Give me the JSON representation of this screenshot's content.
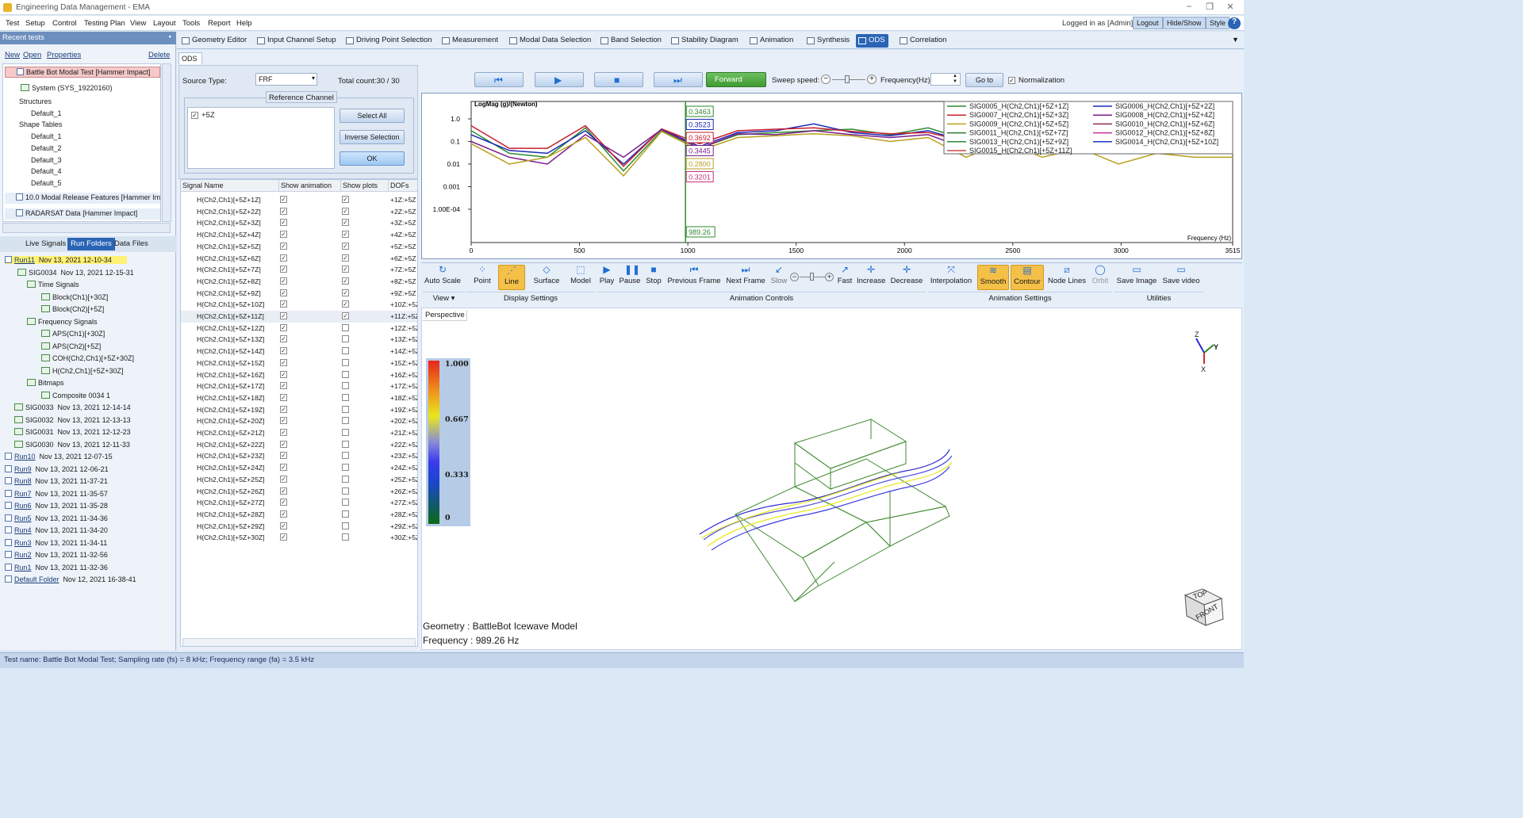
{
  "app": {
    "title": "Engineering Data Management - EMA",
    "menu": [
      "Test",
      "Setup",
      "Control",
      "Testing Plan",
      "View",
      "Layout",
      "Tools",
      "Report",
      "Help"
    ],
    "logged_in": "Logged in as [Admin]",
    "header_buttons": [
      "Logout",
      "Hide/Show",
      "Style"
    ]
  },
  "modules": [
    "Geometry Editor",
    "Input Channel Setup",
    "Driving Point Selection",
    "Measurement",
    "Modal Data Selection",
    "Band Selection",
    "Stability Diagram",
    "Animation",
    "Synthesis",
    "ODS",
    "Correlation"
  ],
  "active_module": "ODS",
  "recent": {
    "header": "Recent tests",
    "actions": [
      "New",
      "Open",
      "Properties",
      "Delete"
    ],
    "items": [
      {
        "label": "Battle Bot Modal Test   [Hammer Impact]"
      },
      {
        "label": "System (SYS_19220160)"
      },
      {
        "label": "Structures"
      },
      {
        "label": "Default_1"
      },
      {
        "label": "Shape Tables"
      },
      {
        "label": "Default_1"
      },
      {
        "label": "Default_2"
      },
      {
        "label": "Default_3"
      },
      {
        "label": "Default_4"
      },
      {
        "label": "Default_5"
      },
      {
        "label": "10.0 Modal Release Features   [Hammer Im"
      },
      {
        "label": "RADARSAT Data   [Hammer Impact]"
      }
    ]
  },
  "left_tabs": [
    "Live Signals",
    "Run Folders",
    "Data Files"
  ],
  "active_left_tab": "Run Folders",
  "runs": [
    {
      "name": "Run11",
      "date": "Nov 13, 2021 12-10-34"
    },
    {
      "name": "SIG0034",
      "date": "Nov 13, 2021 12-15-31"
    },
    {
      "name": "Time Signals",
      "date": ""
    },
    {
      "name": "Block(Ch1)[+30Z]",
      "date": ""
    },
    {
      "name": "Block(Ch2)[+5Z]",
      "date": ""
    },
    {
      "name": "Frequency Signals",
      "date": ""
    },
    {
      "name": "APS(Ch1)[+30Z]",
      "date": ""
    },
    {
      "name": "APS(Ch2)[+5Z]",
      "date": ""
    },
    {
      "name": "COH(Ch2,Ch1)[+5Z+30Z]",
      "date": ""
    },
    {
      "name": "H(Ch2,Ch1)[+5Z+30Z]",
      "date": ""
    },
    {
      "name": "Bitmaps",
      "date": ""
    },
    {
      "name": "Composite 0034 1",
      "date": ""
    },
    {
      "name": "SIG0033",
      "date": "Nov 13, 2021 12-14-14"
    },
    {
      "name": "SIG0032",
      "date": "Nov 13, 2021 12-13-13"
    },
    {
      "name": "SIG0031",
      "date": "Nov 13, 2021 12-12-23"
    },
    {
      "name": "SIG0030",
      "date": "Nov 13, 2021 12-11-33"
    },
    {
      "name": "Run10",
      "date": "Nov 13, 2021 12-07-15"
    },
    {
      "name": "Run9",
      "date": "Nov 13, 2021 12-06-21"
    },
    {
      "name": "Run8",
      "date": "Nov 13, 2021 11-37-21"
    },
    {
      "name": "Run7",
      "date": "Nov 13, 2021 11-35-57"
    },
    {
      "name": "Run6",
      "date": "Nov 13, 2021 11-35-28"
    },
    {
      "name": "Run5",
      "date": "Nov 13, 2021 11-34-36"
    },
    {
      "name": "Run4",
      "date": "Nov 13, 2021 11-34-20"
    },
    {
      "name": "Run3",
      "date": "Nov 13, 2021 11-34-11"
    },
    {
      "name": "Run2",
      "date": "Nov 13, 2021 11-32-56"
    },
    {
      "name": "Run1",
      "date": "Nov 13, 2021 11-32-36"
    },
    {
      "name": "Default Folder",
      "date": "Nov 12, 2021 16-38-41"
    }
  ],
  "ods": {
    "tab": "ODS",
    "source_type_label": "Source Type:",
    "source_type": "FRF",
    "total_count": "Total count:30 / 30",
    "reference_channel_label": "Reference Channel",
    "reference_channel": "+5Z",
    "buttons": [
      "Select All",
      "Inverse Selection",
      "OK"
    ],
    "columns": [
      "Signal Name",
      "Show animation",
      "Show plots",
      "DOFs"
    ]
  },
  "signals": [
    {
      "name": "H(Ch2,Ch1)[+5Z+1Z]",
      "anim": true,
      "plot": true,
      "dof": "+1Z:+5Z"
    },
    {
      "name": "H(Ch2,Ch1)[+5Z+2Z]",
      "anim": true,
      "plot": true,
      "dof": "+2Z:+5Z"
    },
    {
      "name": "H(Ch2,Ch1)[+5Z+3Z]",
      "anim": true,
      "plot": true,
      "dof": "+3Z:+5Z"
    },
    {
      "name": "H(Ch2,Ch1)[+5Z+4Z]",
      "anim": true,
      "plot": true,
      "dof": "+4Z:+5Z"
    },
    {
      "name": "H(Ch2,Ch1)[+5Z+5Z]",
      "anim": true,
      "plot": true,
      "dof": "+5Z:+5Z"
    },
    {
      "name": "H(Ch2,Ch1)[+5Z+6Z]",
      "anim": true,
      "plot": true,
      "dof": "+6Z:+5Z"
    },
    {
      "name": "H(Ch2,Ch1)[+5Z+7Z]",
      "anim": true,
      "plot": true,
      "dof": "+7Z:+5Z"
    },
    {
      "name": "H(Ch2,Ch1)[+5Z+8Z]",
      "anim": true,
      "plot": true,
      "dof": "+8Z:+5Z"
    },
    {
      "name": "H(Ch2,Ch1)[+5Z+9Z]",
      "anim": true,
      "plot": true,
      "dof": "+9Z:+5Z"
    },
    {
      "name": "H(Ch2,Ch1)[+5Z+10Z]",
      "anim": true,
      "plot": true,
      "dof": "+10Z:+5Z"
    },
    {
      "name": "H(Ch2,Ch1)[+5Z+11Z]",
      "anim": true,
      "plot": true,
      "dof": "+11Z:+5Z"
    },
    {
      "name": "H(Ch2,Ch1)[+5Z+12Z]",
      "anim": true,
      "plot": false,
      "dof": "+12Z:+5Z"
    },
    {
      "name": "H(Ch2,Ch1)[+5Z+13Z]",
      "anim": true,
      "plot": false,
      "dof": "+13Z:+5Z"
    },
    {
      "name": "H(Ch2,Ch1)[+5Z+14Z]",
      "anim": true,
      "plot": false,
      "dof": "+14Z:+5Z"
    },
    {
      "name": "H(Ch2,Ch1)[+5Z+15Z]",
      "anim": true,
      "plot": false,
      "dof": "+15Z:+5Z"
    },
    {
      "name": "H(Ch2,Ch1)[+5Z+16Z]",
      "anim": true,
      "plot": false,
      "dof": "+16Z:+5Z"
    },
    {
      "name": "H(Ch2,Ch1)[+5Z+17Z]",
      "anim": true,
      "plot": false,
      "dof": "+17Z:+5Z"
    },
    {
      "name": "H(Ch2,Ch1)[+5Z+18Z]",
      "anim": true,
      "plot": false,
      "dof": "+18Z:+5Z"
    },
    {
      "name": "H(Ch2,Ch1)[+5Z+19Z]",
      "anim": true,
      "plot": false,
      "dof": "+19Z:+5Z"
    },
    {
      "name": "H(Ch2,Ch1)[+5Z+20Z]",
      "anim": true,
      "plot": false,
      "dof": "+20Z:+5Z"
    },
    {
      "name": "H(Ch2,Ch1)[+5Z+21Z]",
      "anim": true,
      "plot": false,
      "dof": "+21Z:+5Z"
    },
    {
      "name": "H(Ch2,Ch1)[+5Z+22Z]",
      "anim": true,
      "plot": false,
      "dof": "+22Z:+5Z"
    },
    {
      "name": "H(Ch2,Ch1)[+5Z+23Z]",
      "anim": true,
      "plot": false,
      "dof": "+23Z:+5Z"
    },
    {
      "name": "H(Ch2,Ch1)[+5Z+24Z]",
      "anim": true,
      "plot": false,
      "dof": "+24Z:+5Z"
    },
    {
      "name": "H(Ch2,Ch1)[+5Z+25Z]",
      "anim": true,
      "plot": false,
      "dof": "+25Z:+5Z"
    },
    {
      "name": "H(Ch2,Ch1)[+5Z+26Z]",
      "anim": true,
      "plot": false,
      "dof": "+26Z:+5Z"
    },
    {
      "name": "H(Ch2,Ch1)[+5Z+27Z]",
      "anim": true,
      "plot": false,
      "dof": "+27Z:+5Z"
    },
    {
      "name": "H(Ch2,Ch1)[+5Z+28Z]",
      "anim": true,
      "plot": false,
      "dof": "+28Z:+5Z"
    },
    {
      "name": "H(Ch2,Ch1)[+5Z+29Z]",
      "anim": true,
      "plot": false,
      "dof": "+29Z:+5Z"
    },
    {
      "name": "H(Ch2,Ch1)[+5Z+30Z]",
      "anim": true,
      "plot": false,
      "dof": "+30Z:+5Z"
    }
  ],
  "controls": {
    "forward": "Forward",
    "sweep_speed": "Sweep speed:",
    "frequency_label": "Frequency(Hz):",
    "goto": "Go to",
    "normalization": "Normalization"
  },
  "chart_data": {
    "type": "line",
    "ylabel": "LogMag (g)/(Newton)",
    "xlabel": "Frequency (Hz)",
    "x_ticks": [
      "0",
      "500",
      "1000",
      "1500",
      "2000",
      "2500",
      "3000",
      "3515"
    ],
    "y_ticks": [
      "1.0",
      "0.1",
      "0.01",
      "0.001",
      "1.00E-04"
    ],
    "xlim": [
      0,
      3515
    ],
    "y_log": true,
    "cursor_x": 989.26,
    "cursor_label": "989.26",
    "cursor_values": [
      {
        "v": "0.3463",
        "color": "#2e8b2e"
      },
      {
        "v": "0.3523",
        "color": "#1a2ab8"
      },
      {
        "v": "0.3692",
        "color": "#c81e2e"
      },
      {
        "v": "0.3445",
        "color": "#7a1f8a"
      },
      {
        "v": "0.2800",
        "color": "#b8a020"
      },
      {
        "v": "0.3201",
        "color": "#c8307a"
      }
    ],
    "legend": [
      {
        "name": "SIG0005_H(Ch2,Ch1)[+5Z+1Z]",
        "color": "#2e8b2e"
      },
      {
        "name": "SIG0006_H(Ch2,Ch1)[+5Z+2Z]",
        "color": "#1a2ab8"
      },
      {
        "name": "SIG0007_H(Ch2,Ch1)[+5Z+3Z]",
        "color": "#c81e2e"
      },
      {
        "name": "SIG0008_H(Ch2,Ch1)[+5Z+4Z]",
        "color": "#7a1f8a"
      },
      {
        "name": "SIG0009_H(Ch2,Ch1)[+5Z+5Z]",
        "color": "#b8a020"
      },
      {
        "name": "SIG0010_H(Ch2,Ch1)[+5Z+6Z]",
        "color": "#8a2e4a"
      },
      {
        "name": "SIG0011_H(Ch2,Ch1)[+5Z+7Z]",
        "color": "#2e7a2e"
      },
      {
        "name": "SIG0012_H(Ch2,Ch1)[+5Z+8Z]",
        "color": "#c82e9a"
      },
      {
        "name": "SIG0013_H(Ch2,Ch1)[+5Z+9Z]",
        "color": "#2a8a3a"
      },
      {
        "name": "SIG0014_H(Ch2,Ch1)[+5Z+10Z]",
        "color": "#1a3ac8"
      },
      {
        "name": "SIG0015_H(Ch2,Ch1)[+5Z+11Z]",
        "color": "#c84a4a"
      }
    ],
    "series": [
      {
        "values": [
          0.3,
          0.03,
          0.02,
          0.4,
          0.005,
          0.3,
          0.05,
          0.2,
          0.25,
          0.3,
          0.35,
          0.2,
          0.4,
          0.12,
          0.4,
          0.05,
          0.15,
          0.1,
          0.08,
          0.03,
          0.05
        ]
      },
      {
        "values": [
          0.2,
          0.04,
          0.03,
          0.3,
          0.01,
          0.35,
          0.06,
          0.25,
          0.3,
          0.6,
          0.25,
          0.18,
          0.3,
          0.1,
          0.2,
          0.07,
          0.12,
          0.1,
          0.06,
          0.05,
          0.04
        ]
      },
      {
        "values": [
          0.5,
          0.05,
          0.05,
          0.5,
          0.008,
          0.36,
          0.08,
          0.3,
          0.35,
          0.4,
          0.28,
          0.22,
          0.25,
          0.1,
          0.15,
          0.06,
          0.1,
          0.08,
          0.07,
          0.06,
          0.05
        ]
      },
      {
        "values": [
          0.1,
          0.02,
          0.01,
          0.2,
          0.02,
          0.34,
          0.05,
          0.22,
          0.2,
          0.3,
          0.2,
          0.15,
          0.2,
          0.05,
          0.08,
          0.04,
          0.06,
          0.05,
          0.04,
          0.03,
          0.03
        ]
      },
      {
        "values": [
          0.08,
          0.01,
          0.02,
          0.15,
          0.003,
          0.28,
          0.04,
          0.15,
          0.18,
          0.22,
          0.18,
          0.1,
          0.15,
          0.02,
          0.1,
          0.02,
          0.05,
          0.01,
          0.03,
          0.02,
          0.02
        ]
      }
    ]
  },
  "ribbon": {
    "buttons": [
      "Auto Scale",
      "Point",
      "Line",
      "Surface",
      "Model",
      "Play",
      "Pause",
      "Stop",
      "Previous Frame",
      "Next Frame",
      "Slow",
      "Fast",
      "Increase",
      "Decrease",
      "Interpolation",
      "Smooth",
      "Contour",
      "Node Lines",
      "Orbit",
      "Save Image",
      "Save video"
    ],
    "groups": [
      "View",
      "Display Settings",
      "Animation Controls",
      "Animation Settings",
      "Utilities"
    ]
  },
  "view3d": {
    "tab": "Perspective",
    "colorbar": [
      "1.000",
      "0.667",
      "0.333",
      "0"
    ],
    "geometry": "Geometry : BattleBot Icewave Model",
    "frequency": "Frequency : 989.26 Hz",
    "cube_top": "TOP",
    "cube_front": "FRONT",
    "axes": {
      "z": "Z",
      "y": "Y",
      "x": "X"
    }
  },
  "status": "Test name: Battle Bot Modal Test; Sampling rate (fs) = 8 kHz; Frequency range (fa) = 3.5 kHz"
}
